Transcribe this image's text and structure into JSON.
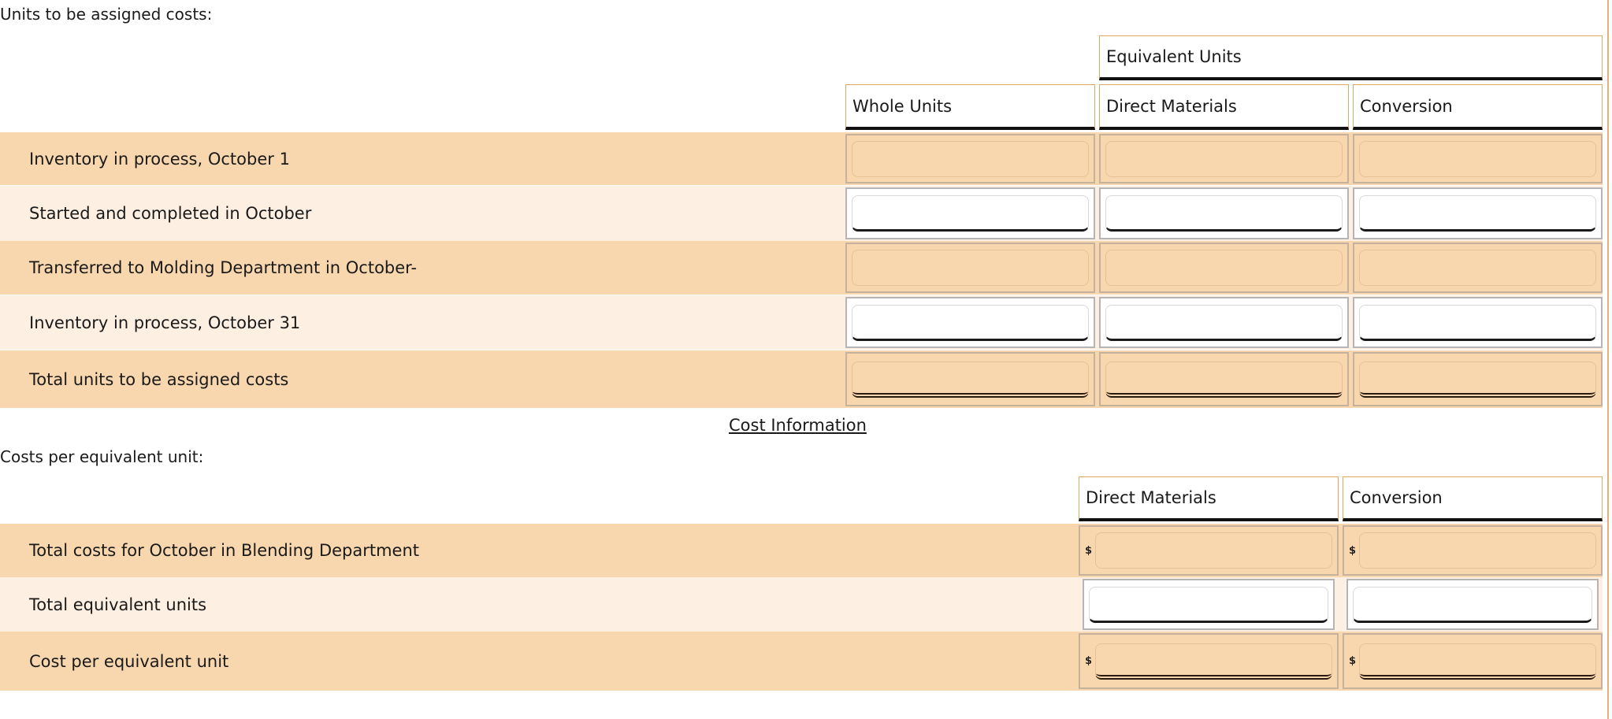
{
  "units_section": {
    "title": "Units to be assigned costs:",
    "group_header": "Equivalent Units",
    "columns": [
      "Whole Units",
      "Direct Materials",
      "Conversion"
    ],
    "rows": [
      {
        "label": "Inventory in process, October 1",
        "style": "dark",
        "values": [
          "",
          "",
          ""
        ]
      },
      {
        "label": "Started and completed in October",
        "style": "light",
        "values": [
          "",
          "",
          ""
        ]
      },
      {
        "label": "Transferred to Molding Department in October-",
        "style": "dark",
        "values": [
          "",
          "",
          ""
        ]
      },
      {
        "label": "Inventory in process, October 31",
        "style": "light",
        "values": [
          "",
          "",
          ""
        ]
      },
      {
        "label": "Total units to be assigned costs",
        "style": "dark",
        "total": true,
        "values": [
          "",
          "",
          ""
        ]
      }
    ]
  },
  "cost_info_link": "Cost Information",
  "cost_section": {
    "title": "Costs per equivalent unit:",
    "columns": [
      "Direct Materials",
      "Conversion"
    ],
    "currency_symbol": "$",
    "rows": [
      {
        "label": "Total costs for October in Blending Department",
        "style": "dark",
        "currency": true,
        "values": [
          "",
          ""
        ]
      },
      {
        "label": "Total equivalent units",
        "style": "light",
        "currency": false,
        "values": [
          "",
          ""
        ]
      },
      {
        "label": "Cost per equivalent unit",
        "style": "dark",
        "currency": true,
        "total": true,
        "values": [
          "",
          ""
        ]
      }
    ]
  },
  "colors": {
    "row_dark": "#f9d7ae",
    "row_light": "#fdefe2",
    "header_border": "#e0a75e"
  }
}
